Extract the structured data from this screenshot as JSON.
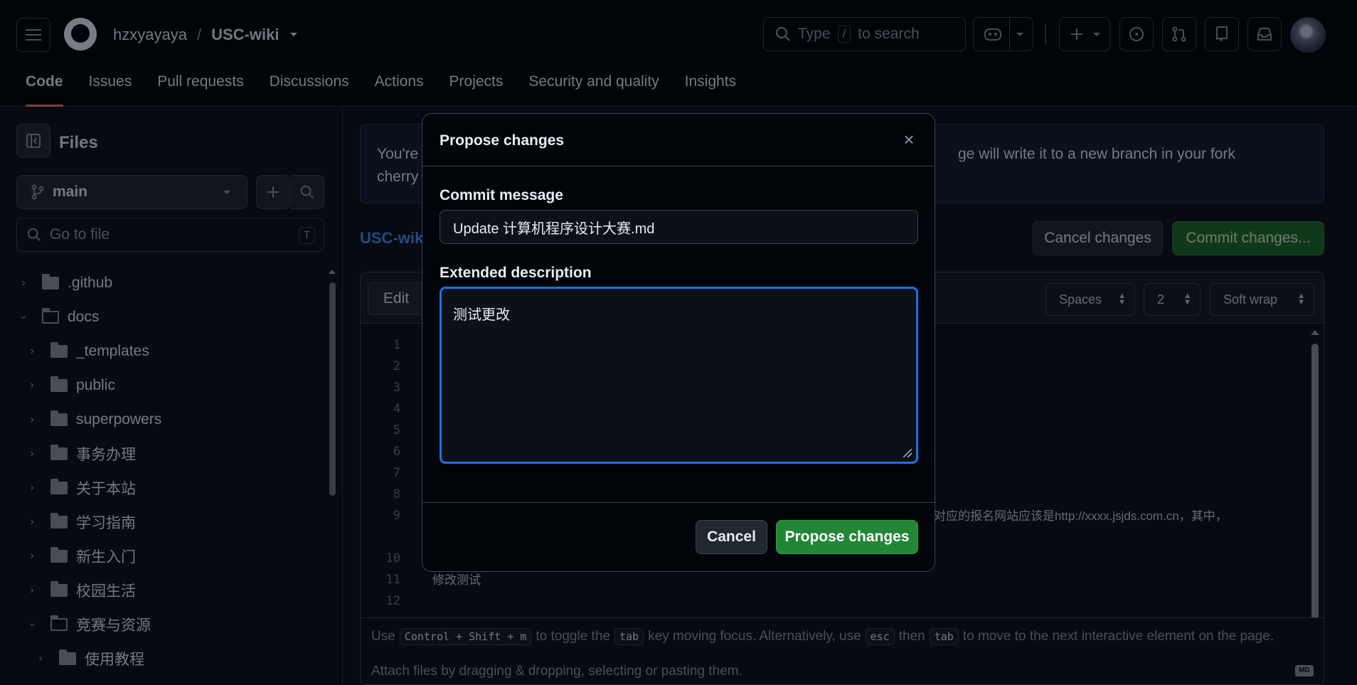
{
  "header": {
    "owner": "hzxyayaya",
    "separator": "/",
    "repo": "USC-wiki",
    "search_prefix": "Type",
    "search_key": "/",
    "search_suffix": "to search"
  },
  "nav": {
    "tabs": [
      "Code",
      "Issues",
      "Pull requests",
      "Discussions",
      "Actions",
      "Projects",
      "Security and quality",
      "Insights"
    ]
  },
  "sidebar": {
    "title": "Files",
    "branch": "main",
    "goto_placeholder": "Go to file",
    "goto_key": "T",
    "tree": [
      {
        "label": ".github",
        "indent": 0,
        "open": false
      },
      {
        "label": "docs",
        "indent": 0,
        "open": true
      },
      {
        "label": "_templates",
        "indent": 1,
        "open": false
      },
      {
        "label": "public",
        "indent": 1,
        "open": false
      },
      {
        "label": "superpowers",
        "indent": 1,
        "open": false
      },
      {
        "label": "事务办理",
        "indent": 1,
        "open": false
      },
      {
        "label": "关于本站",
        "indent": 1,
        "open": false
      },
      {
        "label": "学习指南",
        "indent": 1,
        "open": false
      },
      {
        "label": "新生入门",
        "indent": 1,
        "open": false
      },
      {
        "label": "校园生活",
        "indent": 1,
        "open": false
      },
      {
        "label": "竞赛与资源",
        "indent": 1,
        "open": true
      },
      {
        "label": "使用教程",
        "indent": 2,
        "open": false
      }
    ]
  },
  "main": {
    "banner_l1": "You're",
    "banner_l2": "cherry",
    "banner_r1": "ge will write it to a new branch in your fork",
    "breadcrumb": "USC-wik",
    "cancel_changes": "Cancel changes",
    "commit_changes": "Commit changes...",
    "editor": {
      "edit_tab": "Edit",
      "indent_mode": "Spaces",
      "indent_size": "2",
      "wrap_mode": "Soft wrap",
      "line_numbers": [
        "1",
        "2",
        "3",
        "4",
        "5",
        "6",
        "7",
        "8",
        "9",
        "",
        "10",
        "11",
        "12"
      ],
      "line9_tail": "对应的报名网站应该是http://xxxx.jsjds.com.cn，其中，",
      "line11": "修改测试",
      "footer_hint_1": "Use",
      "footer_hint_key": "Control + Shift + m",
      "footer_hint_2": "to toggle the",
      "footer_hint_tab": "tab",
      "footer_hint_3": "key moving focus. Alternatively, use",
      "footer_hint_esc": "esc",
      "footer_hint_4": "then",
      "footer_hint_tab2": "tab",
      "footer_hint_5": "to move to the next interactive element on the page.",
      "attach": "Attach files by dragging & dropping, selecting or pasting them.",
      "md_badge": "MD"
    }
  },
  "dialog": {
    "title": "Propose changes",
    "close_glyph": "×",
    "commit_label": "Commit message",
    "commit_value": "Update 计算机程序设计大赛.md",
    "desc_label": "Extended description",
    "desc_value": "测试更改",
    "cancel": "Cancel",
    "submit": "Propose changes"
  },
  "colors": {
    "accent_blue": "#1f6feb",
    "primary_green": "#238636",
    "tab_underline": "#f78166"
  }
}
